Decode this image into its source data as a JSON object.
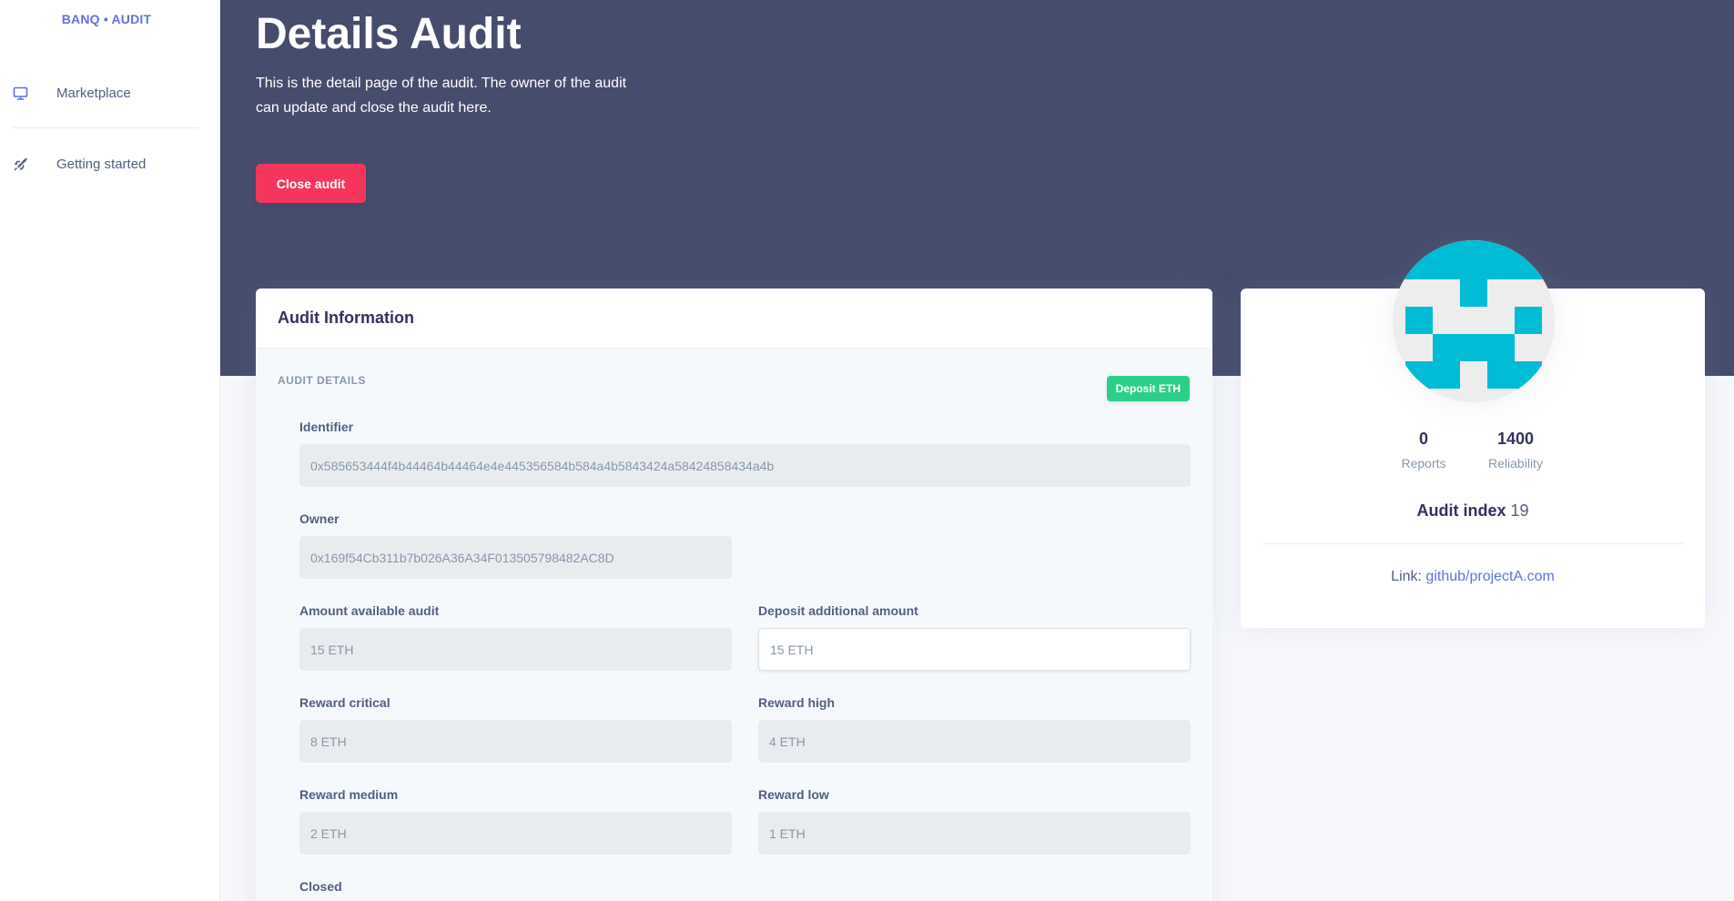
{
  "sidebar": {
    "brand": "BANQ • AUDIT",
    "items": [
      {
        "label": "Marketplace",
        "icon": "monitor-icon",
        "color": "#5e72e4"
      },
      {
        "label": "Getting started",
        "icon": "rocket-icon",
        "color": "#525f7f"
      }
    ]
  },
  "header": {
    "title": "Details Audit",
    "description": "This is the detail page of the audit. The owner of the audit can update and close the audit here.",
    "close_button": "Close audit"
  },
  "audit_card": {
    "title": "Audit Information",
    "section_label": "AUDIT DETAILS",
    "deposit_button": "Deposit ETH",
    "fields": {
      "identifier": {
        "label": "Identifier",
        "value": "0x585653444f4b44464b44464e4e445356584b584a4b5843424a58424858434a4b"
      },
      "owner": {
        "label": "Owner",
        "value": "0x169f54Cb311b7b026A36A34F013505798482AC8D"
      },
      "amount_available": {
        "label": "Amount available audit",
        "value": "15 ETH"
      },
      "deposit_additional": {
        "label": "Deposit additional amount",
        "placeholder": "15 ETH"
      },
      "reward_critical": {
        "label": "Reward critical",
        "value": "8 ETH"
      },
      "reward_high": {
        "label": "Reward high",
        "value": "4 ETH"
      },
      "reward_medium": {
        "label": "Reward medium",
        "value": "2 ETH"
      },
      "reward_low": {
        "label": "Reward low",
        "value": "1 ETH"
      },
      "closed": {
        "label": "Closed"
      }
    }
  },
  "profile": {
    "avatar_icon": "identicon-avatar",
    "avatar_color": "#00bcd4",
    "stats": [
      {
        "value": "0",
        "label": "Reports"
      },
      {
        "value": "1400",
        "label": "Reliability"
      }
    ],
    "audit_index_label": "Audit index",
    "audit_index_value": "19",
    "link_label": "Link:",
    "link_text": "github/projectA.com"
  },
  "colors": {
    "header_bg": "#464c6c",
    "primary": "#5e72e4",
    "danger": "#f5365c",
    "success": "#2dce89"
  }
}
